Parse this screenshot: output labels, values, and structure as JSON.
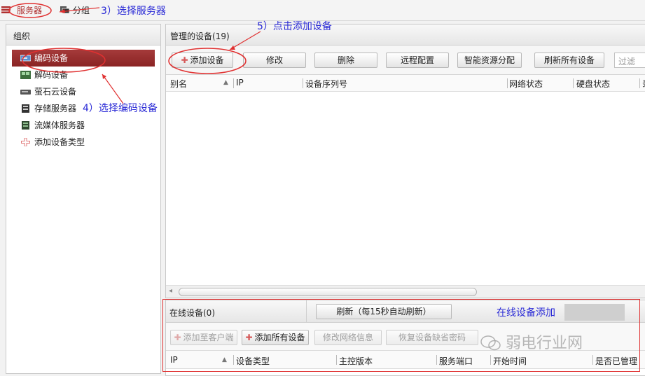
{
  "topbar": {
    "tabs": [
      {
        "label": "服务器",
        "icon": "server-icon",
        "active": true
      },
      {
        "label": "分组",
        "icon": "group-icon",
        "active": false
      }
    ]
  },
  "annotations": {
    "step3": "3）选择服务器",
    "step4": "4）选择编码设备",
    "step5": "5）点击添加设备",
    "online_add": "在线设备添加"
  },
  "left_panel": {
    "title": "组织",
    "items": [
      {
        "label": "编码设备",
        "icon": "encoder-icon",
        "selected": true
      },
      {
        "label": "解码设备",
        "icon": "decoder-icon",
        "selected": false
      },
      {
        "label": "萤石云设备",
        "icon": "cloud-device-icon",
        "selected": false
      },
      {
        "label": "存储服务器",
        "icon": "storage-server-icon",
        "selected": false
      },
      {
        "label": "流媒体服务器",
        "icon": "media-server-icon",
        "selected": false
      },
      {
        "label": "添加设备类型",
        "icon": "plus-icon",
        "selected": false
      }
    ]
  },
  "main_panel": {
    "title": "管理的设备(19)",
    "toolbar": {
      "add_device": "添加设备",
      "modify": "修改",
      "delete": "删除",
      "remote_config": "远程配置",
      "smart_resource": "智能资源分配",
      "refresh_all": "刷新所有设备",
      "filter_placeholder": "过滤"
    },
    "columns": [
      "别名",
      "IP",
      "设备序列号",
      "网络状态",
      "硬盘状态",
      "录"
    ]
  },
  "online_panel": {
    "title": "在线设备(0)",
    "refresh_button": "刷新（每15秒自动刷新）",
    "toolbar": {
      "add_to_client": "添加至客户端",
      "add_all": "添加所有设备",
      "modify_network": "修改网络信息",
      "restore_password": "恢复设备缺省密码"
    },
    "columns": [
      "IP",
      "设备类型",
      "主控版本",
      "服务端口",
      "开始时间",
      "是否已管理"
    ]
  },
  "watermark": "弱电行业网",
  "colors": {
    "accent_red": "#8a2424",
    "annotation_blue": "#2a2ad6",
    "highlight_red": "#e03030"
  }
}
